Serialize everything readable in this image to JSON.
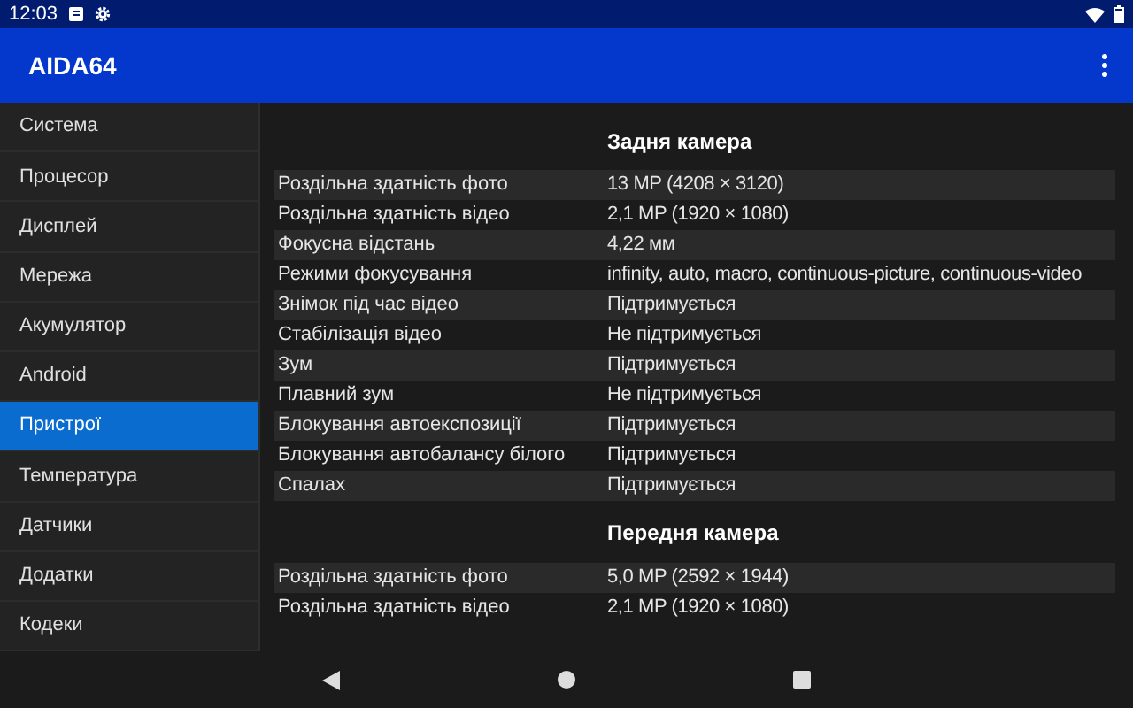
{
  "status_bar": {
    "time": "12:03"
  },
  "app_bar": {
    "title": "AIDA64"
  },
  "sidebar": {
    "items": [
      {
        "label": "Система",
        "selected": false
      },
      {
        "label": "Процесор",
        "selected": false
      },
      {
        "label": "Дисплей",
        "selected": false
      },
      {
        "label": "Мережа",
        "selected": false
      },
      {
        "label": "Акумулятор",
        "selected": false
      },
      {
        "label": "Android",
        "selected": false
      },
      {
        "label": "Пристрої",
        "selected": true
      },
      {
        "label": "Температура",
        "selected": false
      },
      {
        "label": "Датчики",
        "selected": false
      },
      {
        "label": "Додатки",
        "selected": false
      },
      {
        "label": "Кодеки",
        "selected": false
      }
    ]
  },
  "sections": [
    {
      "title": "Задня камера",
      "rows": [
        {
          "label": "Роздільна здатність фото",
          "value": "13 MP (4208 × 3120)"
        },
        {
          "label": "Роздільна здатність відео",
          "value": "2,1 MP (1920 × 1080)"
        },
        {
          "label": "Фокусна відстань",
          "value": "4,22 мм"
        },
        {
          "label": "Режими фокусування",
          "value": "infinity, auto, macro, continuous-picture, continuous-video"
        },
        {
          "label": "Знімок під час відео",
          "value": "Підтримується"
        },
        {
          "label": "Стабілізація відео",
          "value": "Не підтримується"
        },
        {
          "label": "Зум",
          "value": "Підтримується"
        },
        {
          "label": "Плавний зум",
          "value": "Не підтримується"
        },
        {
          "label": "Блокування автоекспозиції",
          "value": "Підтримується"
        },
        {
          "label": "Блокування автобалансу білого",
          "value": "Підтримується"
        },
        {
          "label": "Спалах",
          "value": "Підтримується"
        }
      ]
    },
    {
      "title": "Передня камера",
      "rows": [
        {
          "label": "Роздільна здатність фото",
          "value": "5,0 MP (2592 × 1944)"
        },
        {
          "label": "Роздільна здатність відео",
          "value": "2,1 MP (1920 × 1080)"
        }
      ]
    }
  ]
}
